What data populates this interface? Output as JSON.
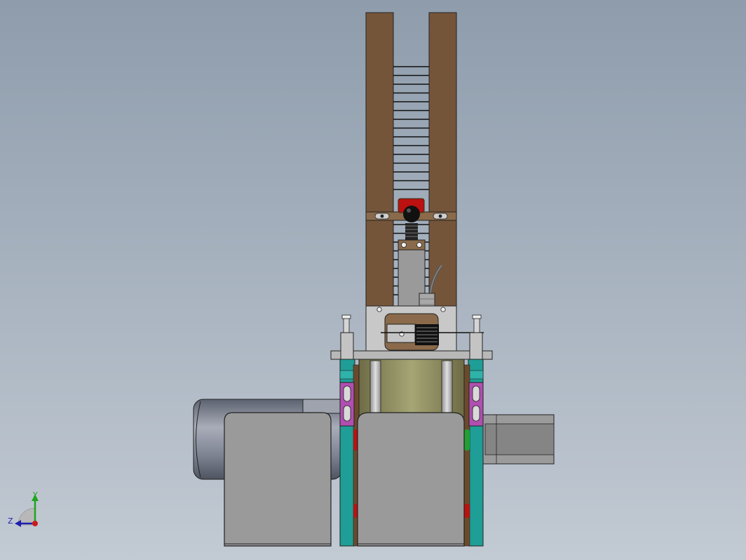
{
  "viewport": {
    "background_top": "#8e9cac",
    "background_bottom": "#c2cad3"
  },
  "colors": {
    "wood": "#75553a",
    "steel": "#c4c4c4",
    "steel_dark": "#8c8c8c",
    "guard": "#9a9a9a",
    "teal": "#1e9e96",
    "magenta": "#b04fb0",
    "olive": "#8f8e5c",
    "motor": "#7c8090",
    "red": "#bb1111",
    "green": "#22a033"
  },
  "triad": {
    "y_label": "Y",
    "z_label": "Z",
    "y_color": "#1fa51f",
    "z_color": "#1f1faf",
    "x_color": "#cc1a1a"
  }
}
